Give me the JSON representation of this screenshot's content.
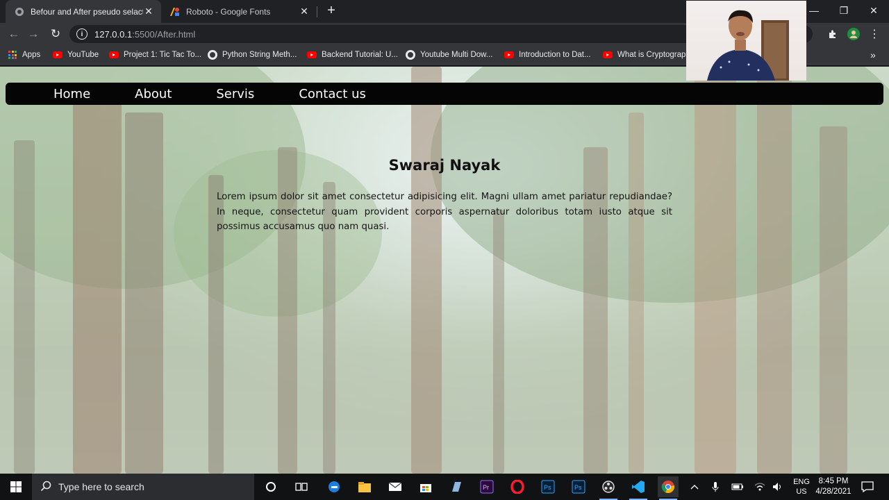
{
  "browser": {
    "tabs": [
      {
        "title": "Befour and After pseudo selacter",
        "active": true
      },
      {
        "title": "Roboto - Google Fonts",
        "active": false
      }
    ],
    "new_tab": "+",
    "window_controls": {
      "minimize": "—",
      "maximize": "❐",
      "close": "✕"
    },
    "url_host": "127.0.0.1",
    "url_path": ":5500/After.html",
    "bookmarks": [
      {
        "label": "Apps",
        "icon": "apps-grid-icon"
      },
      {
        "label": "YouTube",
        "icon": "youtube-icon"
      },
      {
        "label": "Project 1: Tic Tac To...",
        "icon": "youtube-icon"
      },
      {
        "label": "Python String Meth...",
        "icon": "globe-icon"
      },
      {
        "label": "Backend Tutorial: U...",
        "icon": "youtube-icon"
      },
      {
        "label": "Youtube Multi Dow...",
        "icon": "globe-icon"
      },
      {
        "label": "Introduction to Dat...",
        "icon": "youtube-icon"
      },
      {
        "label": "What is Cryptograp...",
        "icon": "youtube-icon"
      }
    ],
    "bookmarks_overflow": "»"
  },
  "site": {
    "nav": [
      "Home",
      "About",
      "Servis",
      "Contact us"
    ],
    "heading": "Swaraj Nayak",
    "paragraph": "Lorem ipsum dolor sit amet consectetur adipisicing elit. Magni ullam amet pariatur repudiandae? In neque, consectetur quam provident corporis aspernatur doloribus totam iusto atque sit possimus accusamus quo nam quasi."
  },
  "taskbar": {
    "search_placeholder": "Type here to search",
    "lang_top": "ENG",
    "lang_bottom": "US",
    "time": "8:45 PM",
    "date": "4/28/2021",
    "apps": [
      "cortana-icon",
      "task-view-icon",
      "edge-icon",
      "file-explorer-icon",
      "mail-icon",
      "store-icon",
      "app-icon",
      "premiere-icon",
      "opera-icon",
      "photoshop-icon",
      "photoshop-icon",
      "obs-icon",
      "vscode-icon",
      "chrome-icon"
    ]
  },
  "colors": {
    "browser_dark": "#202124",
    "browser_toolbar": "#35363a",
    "site_nav": "#050505",
    "taskbar": "#101214"
  }
}
